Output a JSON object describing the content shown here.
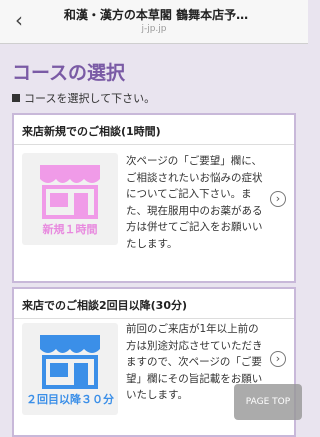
{
  "header": {
    "title": "和漢・漢方の本草閣 鶴舞本店予…",
    "url": "j-jp.jp",
    "back_icon": "chevron-left-icon"
  },
  "main": {
    "heading": "コースの選択",
    "instruction": "コースを選択して下さい。",
    "courses": [
      {
        "title": "来店新規でのご相談(1時間)",
        "icon_label": "新規１時間",
        "icon_color": "#f09be8",
        "description": "次ページの「ご要望」欄に、ご相談されたいお悩みの症状についてご記入下さい。また、現在服用中のお薬がある方は併せてご記入をお願いいたします。"
      },
      {
        "title": "来店でのご相談2回目以降(30分)",
        "icon_label": "２回目以降３０分",
        "icon_color": "#3b8fe8",
        "description": "前回のご来店が1年以上前の方は別途対応させていただきますので、次ページの「ご要望」欄にその旨記載をお願いいたします。"
      }
    ]
  },
  "page_top": "PAGE TOP"
}
